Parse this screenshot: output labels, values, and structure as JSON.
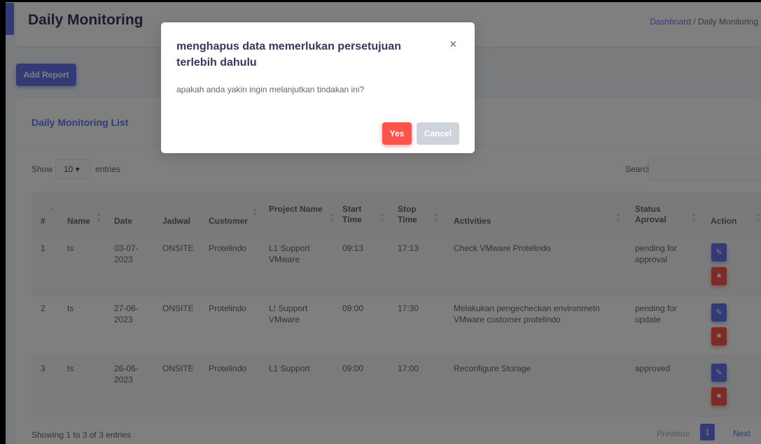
{
  "header": {
    "title": "Daily Monitoring",
    "breadcrumb_link": "Dashboard",
    "breadcrumb_sep": "/",
    "breadcrumb_current": "Daily Monitoring"
  },
  "toolbar": {
    "add_report": "Add Report"
  },
  "card": {
    "title": "Daily Monitoring List"
  },
  "table_controls": {
    "show": "Show",
    "page_size": "10",
    "entries": "entries",
    "search": "Search:"
  },
  "columns": [
    "#",
    "Name",
    "Date",
    "Jadwal",
    "Customer",
    "Project Name",
    "Start Time",
    "Stop Time",
    "Activities",
    "Status Aproval",
    "Action"
  ],
  "rows": [
    {
      "no": "1",
      "name": "ts",
      "date": "03-07-2023",
      "jadwal": "ONSITE",
      "customer": "Protelindo",
      "project": "L1 Support VMware",
      "start": "09:13",
      "stop": "17:13",
      "activities": "Check VMware Protelindo",
      "status": "pending for approval"
    },
    {
      "no": "2",
      "name": "ts",
      "date": "27-06-2023",
      "jadwal": "ONSITE",
      "customer": "Protelindo",
      "project": "L! Support VMware",
      "start": "09:00",
      "stop": "17:30",
      "activities": "Melakukan pengecheckan environmetn VMware customer protelindo",
      "status": "pending for update"
    },
    {
      "no": "3",
      "name": "ts",
      "date": "26-06-2023",
      "jadwal": "ONSITE",
      "customer": "Protelindo",
      "project": "L1 Support",
      "start": "09:00",
      "stop": "17:00",
      "activities": "Reconfigure Storage",
      "status": "approved"
    }
  ],
  "footer": {
    "info": "Showing 1 to 3 of 3 entries",
    "previous": "Previous",
    "page": "1",
    "next": "Next"
  },
  "modal": {
    "title": "menghapus data memerlukan persetujuan terlebih dahulu",
    "body": "apakah anda yakin ingin melanjutkan tindakan ini?",
    "yes": "Yes",
    "cancel": "Cancel",
    "close": "×"
  },
  "icons": {
    "edit": "pencil-icon",
    "delete": "trash-icon",
    "sort": "sort-arrows-icon",
    "select_arrow": "updown-caret-icon"
  },
  "colors": {
    "primary": "#6777ef",
    "danger": "#fc544b",
    "secondary": "#cdd3d8"
  }
}
